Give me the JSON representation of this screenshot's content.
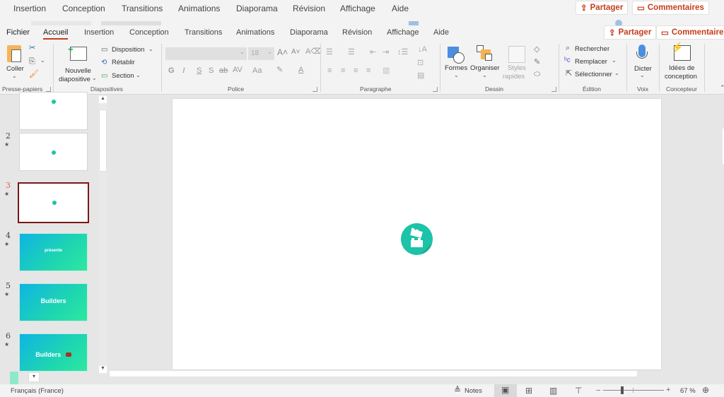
{
  "ghost_tabs": [
    "Insertion",
    "Conception",
    "Transitions",
    "Animations",
    "Diaporama",
    "Révision",
    "Affichage",
    "Aide"
  ],
  "ghost_actions": {
    "share": "Partager",
    "comments": "Commentaires"
  },
  "tabs": {
    "file": "Fichier",
    "items": [
      "Accueil",
      "Insertion",
      "Conception",
      "Transitions",
      "Animations",
      "Diaporama",
      "Révision",
      "Affichage",
      "Aide"
    ],
    "active": "Accueil"
  },
  "actions": {
    "share": "Partager",
    "comments": "Commentaires"
  },
  "ribbon": {
    "clipboard": {
      "label": "Presse-papiers",
      "paste": "Coller"
    },
    "slides": {
      "label": "Diapositives",
      "new_slide_1": "Nouvelle",
      "new_slide_2": "diapositive",
      "layout": "Disposition",
      "reset": "Rétablir",
      "section": "Section"
    },
    "font": {
      "label": "Police",
      "font_name": "",
      "font_size": "18",
      "bold": "G",
      "italic": "I",
      "underline": "S",
      "shadow": "S",
      "strike": "ab",
      "spacing": "AV",
      "case": "Aa"
    },
    "paragraph": {
      "label": "Paragraphe"
    },
    "drawing": {
      "label": "Dessin",
      "shapes": "Formes",
      "arrange": "Organiser",
      "quick_styles_1": "Styles",
      "quick_styles_2": "rapides"
    },
    "editing": {
      "label": "Édition",
      "find": "Rechercher",
      "replace": "Remplacer",
      "select": "Sélectionner"
    },
    "voice": {
      "label": "Voix",
      "dictate": "Dicter"
    },
    "designer": {
      "label": "Concepteur",
      "ideas_1": "Idées de",
      "ideas_2": "conception"
    }
  },
  "slides": [
    {
      "number": "",
      "type": "logo-dot",
      "text": ""
    },
    {
      "number": "2",
      "type": "logo-dot",
      "text": ""
    },
    {
      "number": "3",
      "type": "logo-dot",
      "text": "",
      "selected": true
    },
    {
      "number": "4",
      "type": "gradient",
      "text": "présente"
    },
    {
      "number": "5",
      "type": "gradient",
      "text": "Builders"
    },
    {
      "number": "6",
      "type": "gradient",
      "text": "Builders"
    }
  ],
  "status": {
    "language": "Français (France)",
    "notes": "Notes",
    "zoom": "67 %",
    "zoom_minus": "−",
    "zoom_plus": "+",
    "zoom_level_percent": 67
  },
  "colors": {
    "accent": "#c43e1c",
    "logo": "#1cc3a8",
    "selected_border": "#7a1717"
  }
}
